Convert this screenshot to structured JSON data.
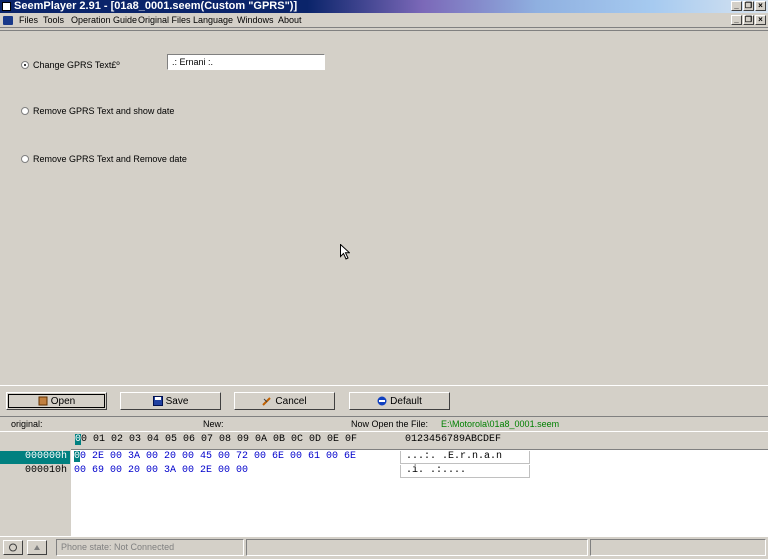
{
  "window": {
    "title": "SeemPlayer 2.91 - [01a8_0001.seem(Custom \"GPRS\")]"
  },
  "menu": [
    "Files",
    "Tools",
    "Operation Guide",
    "Original Files",
    "Language",
    "Windows",
    "About"
  ],
  "options": {
    "change_label": "Change GPRS Text£º",
    "change_value": ".: Ernani :.",
    "remove_show_date_label": "Remove GPRS Text and show date",
    "remove_date_label": "Remove GPRS Text and Remove date",
    "selected": "change"
  },
  "buttons": {
    "open": "Open",
    "save": "Save",
    "cancel": "Cancel",
    "default": "Default"
  },
  "info": {
    "original_label": "original:",
    "new_label": "New:",
    "now_open_label": "Now Open the File:",
    "file_path": "E:\\Motorola\\01a8_0001.seem"
  },
  "hex": {
    "header_first": "0",
    "header_rest": "0 01 02 03 04 05 06 07 08 09 0A 0B 0C 0D 0E 0F",
    "ascii_header": "0123456789ABCDEF",
    "rows": [
      {
        "offset": "000000h",
        "first": "0",
        "rest": "0 2E 00 3A 00 20 00 45 00 72 00 6E 00 61 00 6E",
        "ascii": "...:. .E.r.n.a.n"
      },
      {
        "offset": "000010h",
        "first": "",
        "rest": "00 69 00 20 00 3A 00 2E 00 00",
        "ascii": ".i. .:...."
      }
    ]
  },
  "status": {
    "phone_state": "Phone state: Not Connected"
  },
  "colors": {
    "title_start": "#0a246a",
    "hex_blue": "#0000cc",
    "path_green": "#008000",
    "selection_teal": "#008080"
  }
}
